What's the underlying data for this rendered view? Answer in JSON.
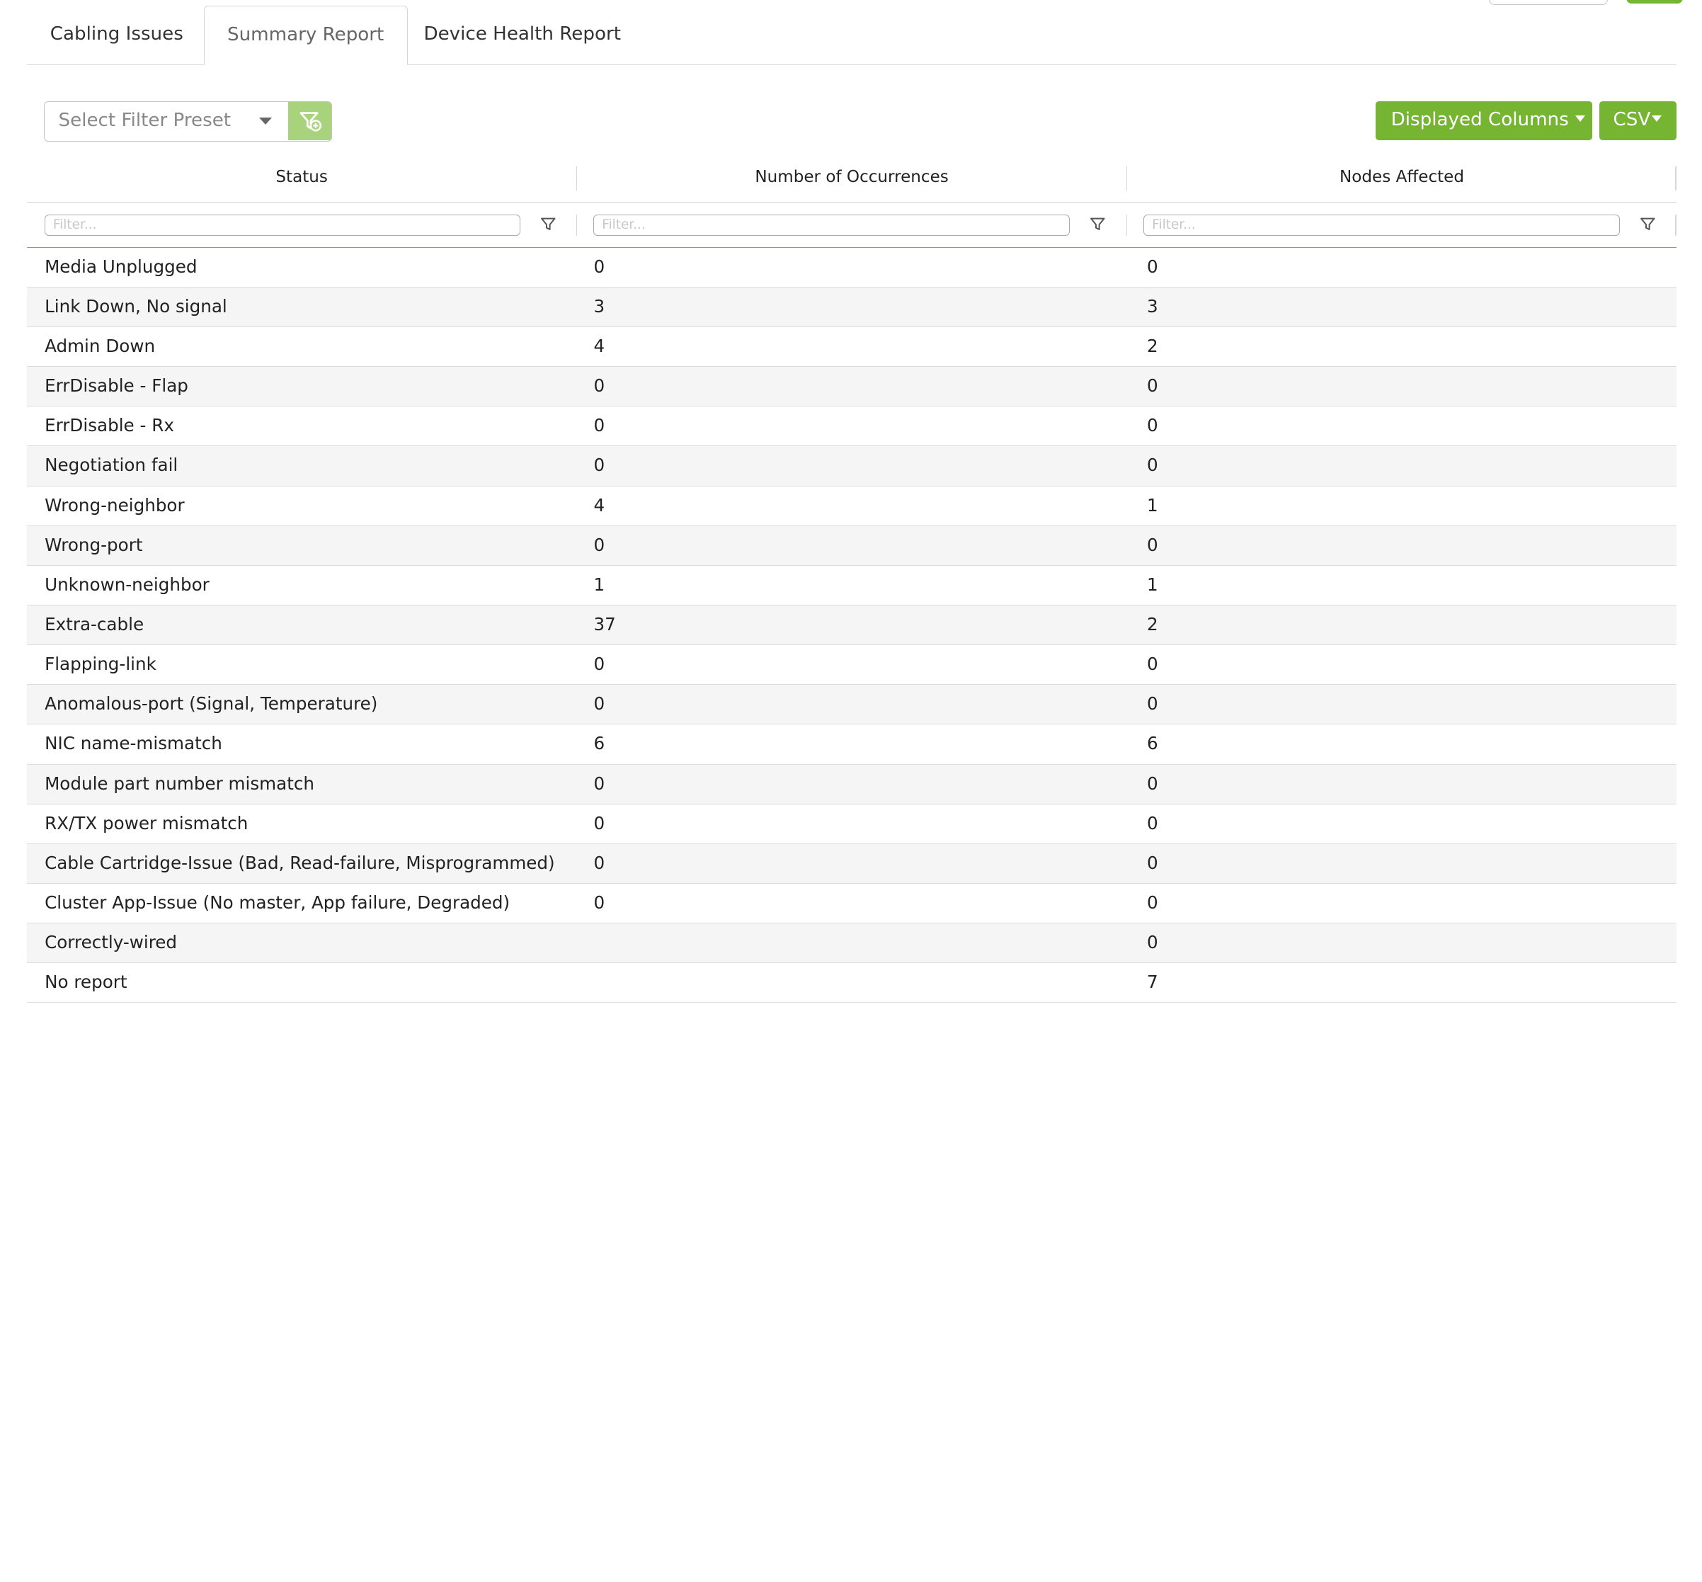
{
  "tabs": [
    {
      "label": "Cabling Issues",
      "active": false
    },
    {
      "label": "Summary Report",
      "active": true
    },
    {
      "label": "Device Health Report",
      "active": false
    }
  ],
  "toolbar": {
    "filter_preset_placeholder": "Select Filter Preset",
    "displayed_columns_label": "Displayed Columns",
    "csv_label": "CSV"
  },
  "table": {
    "columns": [
      "Status",
      "Number of Occurrences",
      "Nodes Affected"
    ],
    "filter_placeholder": "Filter...",
    "rows": [
      [
        "Media Unplugged",
        "0",
        "0"
      ],
      [
        "Link Down, No signal",
        "3",
        "3"
      ],
      [
        "Admin Down",
        "4",
        "2"
      ],
      [
        "ErrDisable - Flap",
        "0",
        "0"
      ],
      [
        "ErrDisable - Rx",
        "0",
        "0"
      ],
      [
        "Negotiation fail",
        "0",
        "0"
      ],
      [
        "Wrong-neighbor",
        "4",
        "1"
      ],
      [
        "Wrong-port",
        "0",
        "0"
      ],
      [
        "Unknown-neighbor",
        "1",
        "1"
      ],
      [
        "Extra-cable",
        "37",
        "2"
      ],
      [
        "Flapping-link",
        "0",
        "0"
      ],
      [
        "Anomalous-port (Signal, Temperature)",
        "0",
        "0"
      ],
      [
        "NIC name-mismatch",
        "6",
        "6"
      ],
      [
        "Module part number mismatch",
        "0",
        "0"
      ],
      [
        "RX/TX power mismatch",
        "0",
        "0"
      ],
      [
        "Cable Cartridge-Issue (Bad, Read-failure, Misprogrammed)",
        "0",
        "0"
      ],
      [
        "Cluster App-Issue (No master, App failure, Degraded)",
        "0",
        "0"
      ],
      [
        "Correctly-wired",
        "",
        "0"
      ],
      [
        "No report",
        "",
        "7"
      ]
    ]
  },
  "colors": {
    "accent_green": "#76b532",
    "accent_green_light": "#a9d27d",
    "row_alt": "#f5f5f5"
  }
}
